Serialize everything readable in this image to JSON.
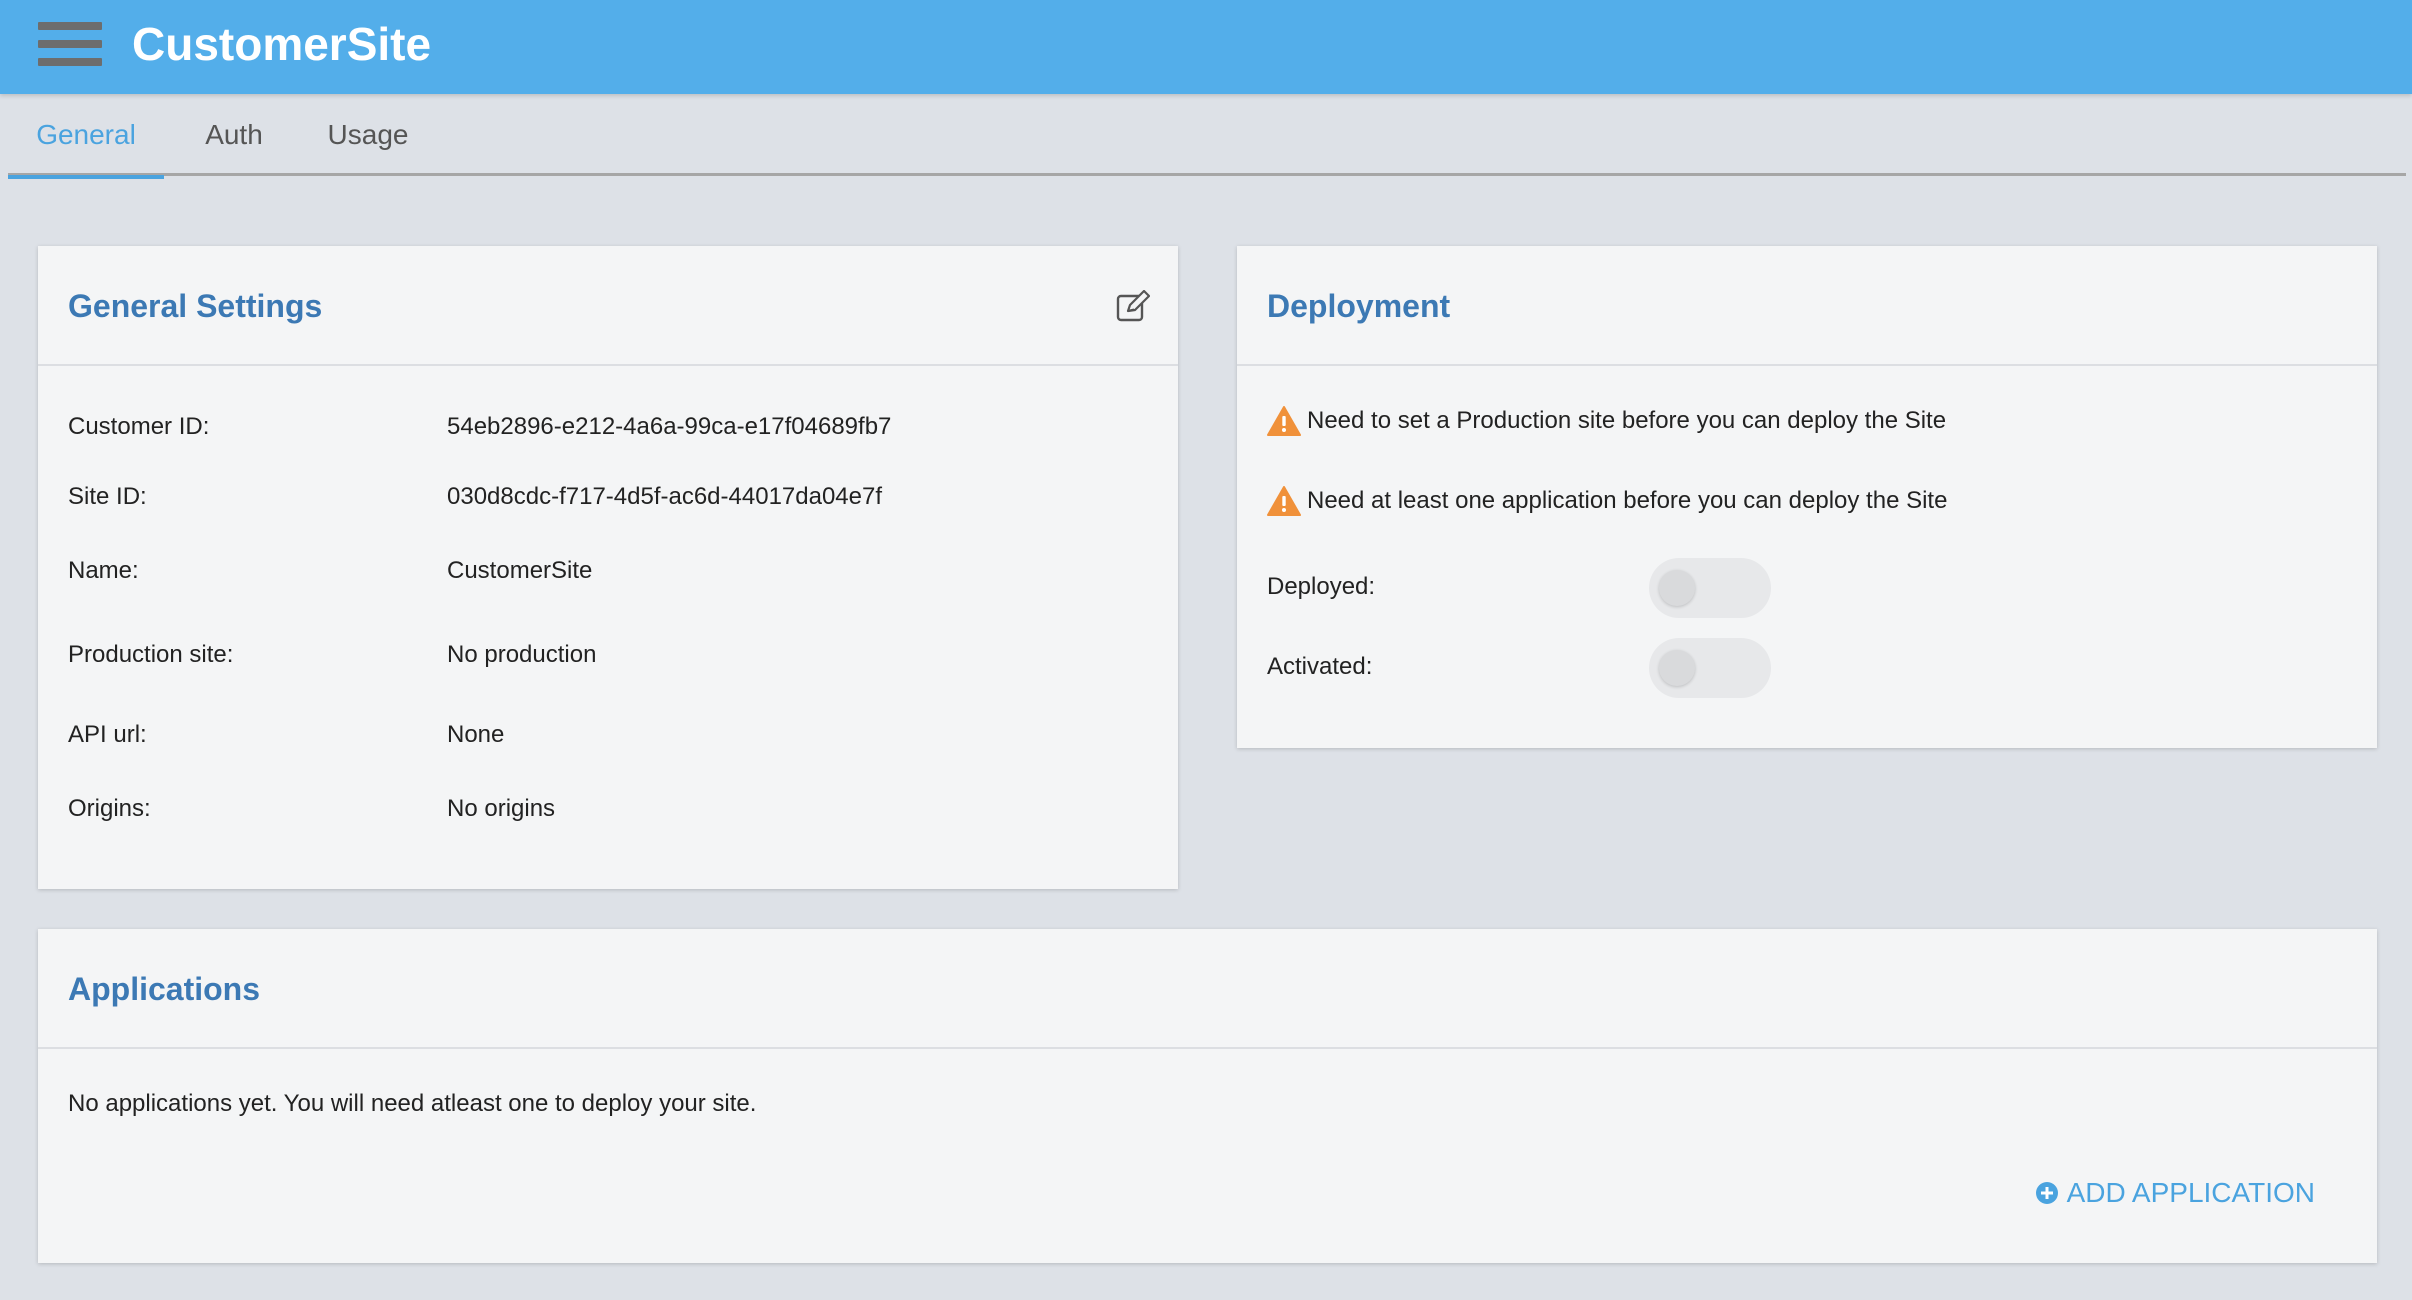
{
  "app": {
    "title": "CustomerSite"
  },
  "tabs": [
    {
      "label": "General",
      "active": true
    },
    {
      "label": "Auth",
      "active": false
    },
    {
      "label": "Usage",
      "active": false
    }
  ],
  "general_settings": {
    "title": "General Settings",
    "rows": [
      {
        "label": "Customer ID:",
        "value": "54eb2896-e212-4a6a-99ca-e17f04689fb7"
      },
      {
        "label": "Site ID:",
        "value": "030d8cdc-f717-4d5f-ac6d-44017da04e7f"
      },
      {
        "label": "Name:",
        "value": "CustomerSite"
      },
      {
        "label": "Production site:",
        "value": "No production"
      },
      {
        "label": "API url:",
        "value": "None"
      },
      {
        "label": "Origins:",
        "value": "No origins"
      }
    ]
  },
  "deployment": {
    "title": "Deployment",
    "warnings": [
      "Need to set a Production site before you can deploy the Site",
      "Need at least one application before you can deploy the Site"
    ],
    "toggles": [
      {
        "label": "Deployed:",
        "on": false
      },
      {
        "label": "Activated:",
        "on": false
      }
    ]
  },
  "applications": {
    "title": "Applications",
    "empty_message": "No applications yet. You will need atleast one to deploy your site.",
    "add_label": "ADD APPLICATION"
  },
  "colors": {
    "topbar": "#53aeea",
    "accent": "#4aa3df",
    "card_title": "#3c79b4",
    "warning": "#f0913a"
  }
}
